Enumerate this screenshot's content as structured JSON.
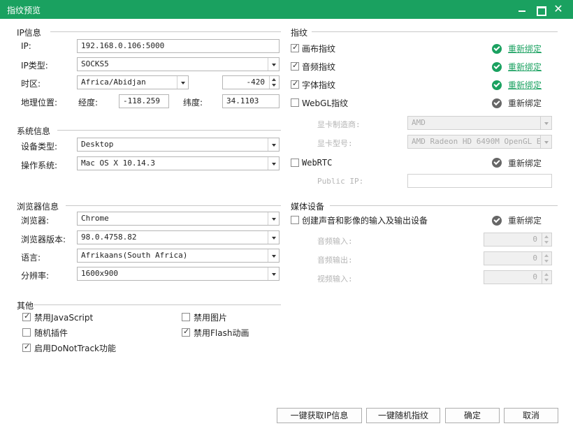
{
  "window": {
    "title": "指纹预览"
  },
  "colors": {
    "accent": "#1aa160",
    "status_ok": "#1aa160",
    "status_neutral": "#666666"
  },
  "ip_section": {
    "header": "IP信息",
    "ip_label": "IP:",
    "ip_value": "192.168.0.106:5000",
    "ip_type_label": "IP类型:",
    "ip_type_value": "SOCKS5",
    "timezone_label": "时区:",
    "timezone_value": "Africa/Abidjan",
    "timezone_offset": "-420",
    "geo_label": "地理位置:",
    "longitude_label": "经度:",
    "longitude_value": "-118.259",
    "latitude_label": "纬度:",
    "latitude_value": "34.1103"
  },
  "system_section": {
    "header": "系统信息",
    "device_type_label": "设备类型:",
    "device_type_value": "Desktop",
    "os_label": "操作系统:",
    "os_value": "Mac OS X 10.14.3"
  },
  "browser_section": {
    "header": "浏览器信息",
    "browser_label": "浏览器:",
    "browser_value": "Chrome",
    "version_label": "浏览器版本:",
    "version_value": "98.0.4758.82",
    "language_label": "语言:",
    "language_value": "Afrikaans(South Africa)",
    "resolution_label": "分辨率:",
    "resolution_value": "1600x900"
  },
  "other_section": {
    "header": "其他",
    "options": [
      {
        "label": "禁用JavaScript",
        "checked": true
      },
      {
        "label": "禁用图片",
        "checked": false
      },
      {
        "label": "随机插件",
        "checked": false
      },
      {
        "label": "禁用Flash动画",
        "checked": true
      },
      {
        "label": "启用DoNotTrack功能",
        "checked": true
      }
    ]
  },
  "fingerprint_section": {
    "header": "指纹",
    "items": [
      {
        "label": "画布指纹",
        "checked": true,
        "rebind": "重新绑定",
        "active": true
      },
      {
        "label": "音频指纹",
        "checked": true,
        "rebind": "重新绑定",
        "active": true
      },
      {
        "label": "字体指纹",
        "checked": true,
        "rebind": "重新绑定",
        "active": true
      },
      {
        "label": "WebGL指纹",
        "checked": false,
        "rebind": "重新绑定",
        "active": false
      }
    ],
    "gpu_vendor_label": "显卡制造商:",
    "gpu_vendor_value": "AMD",
    "gpu_model_label": "显卡型号:",
    "gpu_model_value": "AMD Radeon HD 6490M OpenGL E",
    "webrtc": {
      "label": "WebRTC",
      "checked": false,
      "rebind": "重新绑定"
    },
    "public_ip_label": "Public IP:",
    "public_ip_value": ""
  },
  "media_section": {
    "header": "媒体设备",
    "create_label": "创建声音和影像的输入及输出设备",
    "create_checked": false,
    "rebind": "重新绑定",
    "audio_input_label": "音频输入:",
    "audio_input_value": "0",
    "audio_output_label": "音频输出:",
    "audio_output_value": "0",
    "video_input_label": "视频输入:",
    "video_input_value": "0"
  },
  "footer": {
    "get_ip_label": "一键获取IP信息",
    "random_fp_label": "一键随机指纹",
    "ok_label": "确定",
    "cancel_label": "取消"
  }
}
